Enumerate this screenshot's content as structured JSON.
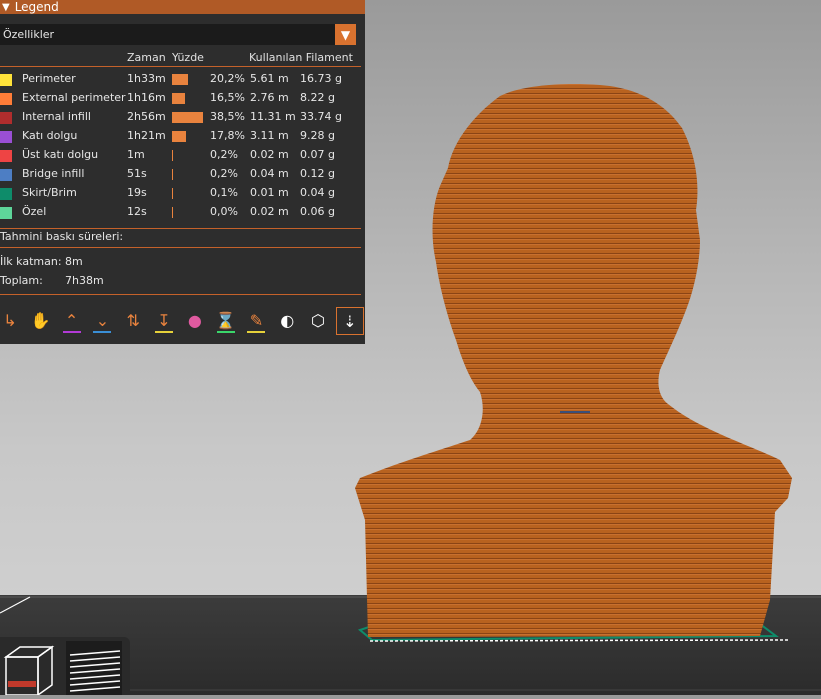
{
  "legend": {
    "title": "Legend",
    "view_type": "Özellikler",
    "columns": {
      "time": "Zaman",
      "percent": "Yüzde",
      "used_filament": "Kullanılan Filament"
    },
    "rows": [
      {
        "name": "Perimeter",
        "time": "1h33m",
        "percent": "20,2%",
        "bar": 0.202,
        "length": "5.61 m",
        "weight": "16.73 g",
        "color": "#ffe33a"
      },
      {
        "name": "External perimeter",
        "time": "1h16m",
        "percent": "16,5%",
        "bar": 0.165,
        "length": "2.76 m",
        "weight": "8.22 g",
        "color": "#ff7d38"
      },
      {
        "name": "Internal infill",
        "time": "2h56m",
        "percent": "38,5%",
        "bar": 0.385,
        "length": "11.31 m",
        "weight": "33.74 g",
        "color": "#b02d2d"
      },
      {
        "name": "Katı dolgu",
        "time": "1h21m",
        "percent": "17,8%",
        "bar": 0.178,
        "length": "3.11 m",
        "weight": "9.28 g",
        "color": "#9a4fd4"
      },
      {
        "name": "Üst katı dolgu",
        "time": "1m",
        "percent": "0,2%",
        "bar": 0.002,
        "length": "0.02 m",
        "weight": "0.07 g",
        "color": "#ee4444"
      },
      {
        "name": "Bridge infill",
        "time": "51s",
        "percent": "0,2%",
        "bar": 0.002,
        "length": "0.04 m",
        "weight": "0.12 g",
        "color": "#4d7ec4"
      },
      {
        "name": "Skirt/Brim",
        "time": "19s",
        "percent": "0,1%",
        "bar": 0.001,
        "length": "0.01 m",
        "weight": "0.04 g",
        "color": "#0e8c6a"
      },
      {
        "name": "Özel",
        "time": "12s",
        "percent": "0,0%",
        "bar": 0.0,
        "length": "0.02 m",
        "weight": "0.06 g",
        "color": "#5ed69a"
      }
    ],
    "estimated_times_label": "Tahmini baskı süreleri:",
    "first_layer_label": "İlk katman:",
    "first_layer_value": "8m",
    "total_label": "Toplam:",
    "total_value": "7h38m"
  },
  "toolbar": [
    {
      "icon": "travel-icon",
      "underline": ""
    },
    {
      "icon": "wipe-icon",
      "underline": ""
    },
    {
      "icon": "retractions-icon",
      "underline": "#b23ad6"
    },
    {
      "icon": "deretractions-icon",
      "underline": "#3a8fd6"
    },
    {
      "icon": "seams-icon",
      "underline": ""
    },
    {
      "icon": "tool-changes-icon",
      "underline": "#e6d13a"
    },
    {
      "icon": "color-changes-icon",
      "underline": ""
    },
    {
      "icon": "pause-prints-icon",
      "underline": "#3ad66a"
    },
    {
      "icon": "custom-gcodes-icon",
      "underline": "#e6d13a"
    },
    {
      "icon": "center-of-gravity-icon",
      "underline": ""
    },
    {
      "icon": "shells-icon",
      "underline": ""
    },
    {
      "icon": "tool-marker-icon",
      "underline": ""
    }
  ],
  "colors": {
    "accent": "#d9722f",
    "panel_bg": "#2d2d2d",
    "model": "#b8621f"
  }
}
